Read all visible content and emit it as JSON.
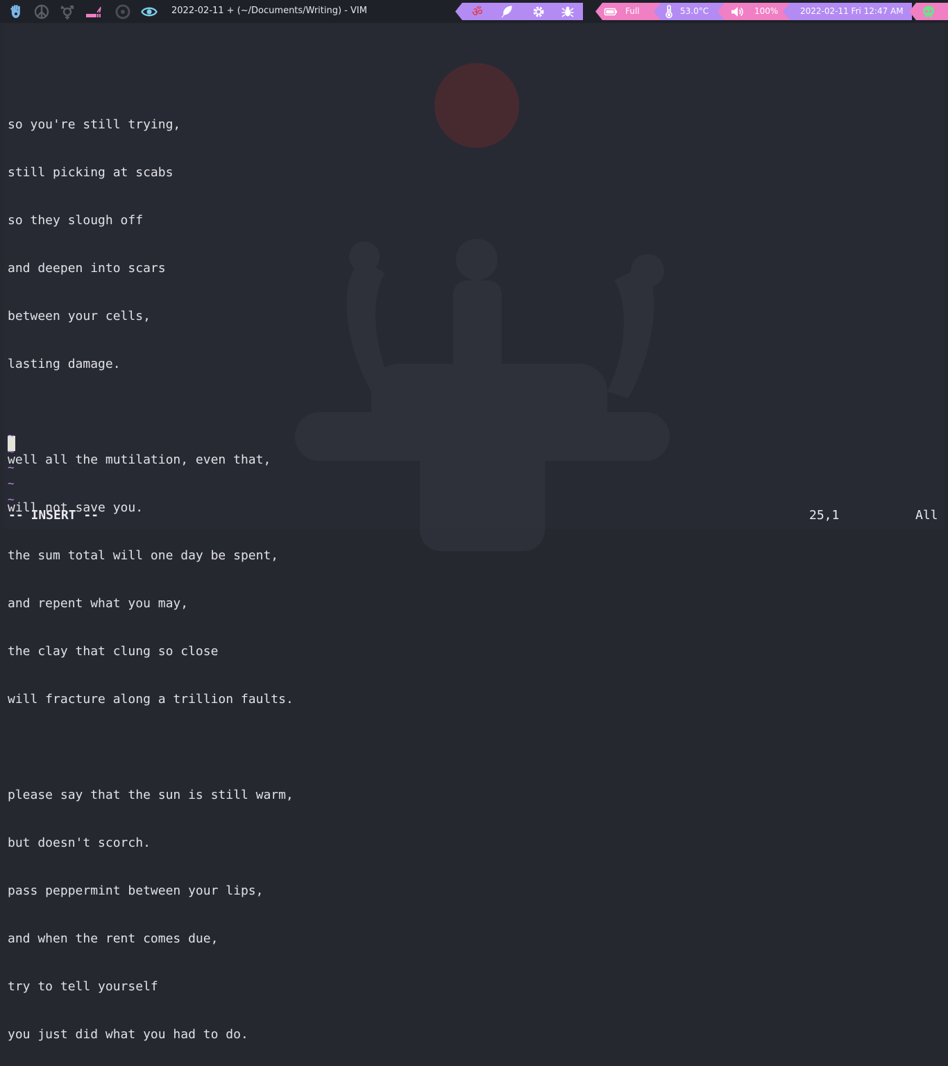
{
  "topbar": {
    "workspaces": [
      {
        "name": "hand-icon",
        "color": "#7ab6e8"
      },
      {
        "name": "peace-icon",
        "color": "#5a5c66"
      },
      {
        "name": "gender-icon",
        "color": "#5a5c66"
      },
      {
        "name": "smoking-icon",
        "color": "#f07fc4"
      },
      {
        "name": "circle-icon",
        "color": "#4a4c55"
      },
      {
        "name": "eye-icon",
        "color": "#7ad0e8"
      }
    ],
    "window_title": "2022-02-11 + (~/Documents/Writing) - VIM",
    "modules": {
      "om_icon": "om-icon",
      "feather_icon": "feather-icon",
      "gear_icon": "gear-icon",
      "bug_icon": "bug-icon",
      "battery_icon": "battery-icon",
      "battery": "Full",
      "temp_icon": "thermometer-icon",
      "temperature": "53.0°C",
      "volume_icon": "speaker-icon",
      "volume": "100%",
      "datetime": "2022-02-11 Fri 12:47 AM",
      "skull_icon": "skull-icon"
    },
    "colors": {
      "purple": "#b38bf3",
      "pink": "#f07fc4",
      "green": "#6be38a"
    }
  },
  "editor": {
    "lines": [
      "so you're still trying,",
      "still picking at scabs",
      "so they slough off",
      "and deepen into scars",
      "between your cells,",
      "lasting damage.",
      "",
      "well all the mutilation, even that,",
      "will not save you.",
      "the sum total will one day be spent,",
      "and repent what you may,",
      "the clay that clung so close",
      "will fracture along a trillion faults.",
      "",
      "please say that the sun is still warm,",
      "but doesn't scorch.",
      "pass peppermint between your lips,",
      "and when the rent comes due,",
      "try to tell yourself",
      "you just did what you had to do."
    ],
    "tildes": [
      "~",
      "~",
      "~",
      "~",
      "~"
    ],
    "mode": "-- INSERT --",
    "position": "25,1",
    "scroll": "All"
  }
}
